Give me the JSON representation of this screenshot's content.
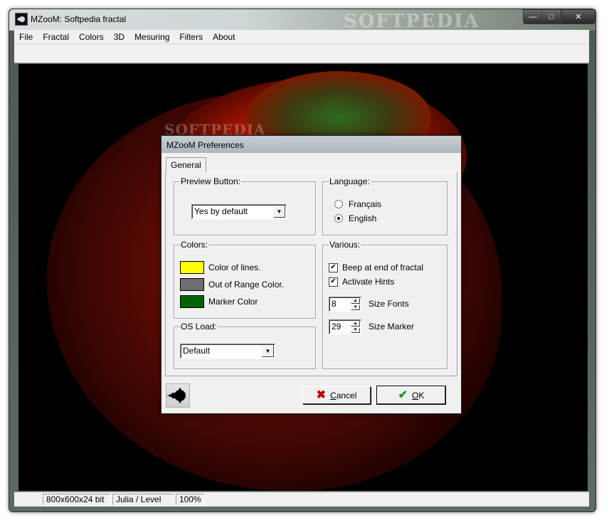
{
  "window": {
    "title": "MZooM: Softpedia fractal",
    "watermark": "SOFTPEDIA",
    "buttons": {
      "minimize": "—",
      "maximize": "□",
      "close": "✕"
    }
  },
  "menu": [
    "File",
    "Fractal",
    "Colors",
    "3D",
    "Mesuring",
    "Filters",
    "About"
  ],
  "canvas": {
    "watermark": "SOFTPEDIA"
  },
  "status": {
    "resolution": "800x600x24 bit",
    "mode": "Julia / Level",
    "zoom": "100%"
  },
  "dialog": {
    "title": "MZooM Preferences",
    "tab": "General",
    "preview": {
      "label": "Preview Button:",
      "value": "Yes by default"
    },
    "language": {
      "label": "Language:",
      "options": [
        "Français",
        "English"
      ],
      "selected": "English"
    },
    "colors": {
      "label": "Colors:",
      "items": [
        {
          "name": "Color of lines.",
          "color": "#ffff00"
        },
        {
          "name": "Out of Range Color.",
          "color": "#6e6e6e"
        },
        {
          "name": "Marker Color",
          "color": "#006400"
        }
      ]
    },
    "osload": {
      "label": "OS Load:",
      "value": "Default"
    },
    "various": {
      "label": "Various:",
      "beep": "Beep at end of fractal",
      "hints": "Activate Hints",
      "size_fonts_value": "8",
      "size_fonts_label": "Size Fonts",
      "size_marker_value": "29",
      "size_marker_label": "Size Marker"
    },
    "cancel_prefix": "C",
    "cancel_rest": "ancel",
    "ok_prefix": "O",
    "ok_rest": "K"
  },
  "icons": {
    "app": "fractal-icon",
    "cancel": "x-icon",
    "ok": "check-icon",
    "footer": "mandelbrot-icon"
  }
}
